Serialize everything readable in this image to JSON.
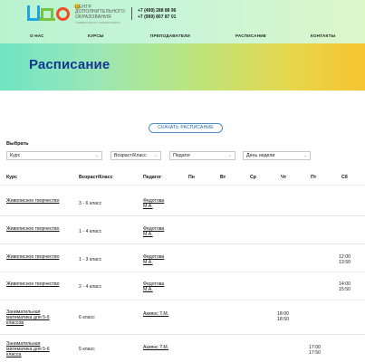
{
  "header": {
    "logo_text": "ЦДО",
    "logo_caption": [
      "ЦЕНТР",
      "ДОПОЛНИТЕЛЬНОГО",
      "ОБРАЗОВАНИЯ"
    ],
    "logo_subcaption": "УНИВЕРСИТЕТА ГУМАНИТАРНЫХ",
    "phones": [
      "+7 (499) 288 88 96",
      "+7 (999) 807 87 01"
    ],
    "nav": [
      "О НАС",
      "КУРСЫ",
      "ПРЕПОДАВАТЕЛИ",
      "РАСПИСАНИЕ",
      "КОНТАКТЫ"
    ]
  },
  "banner": {
    "title": "Расписание"
  },
  "download_button": "СКАЧАТЬ РАСПИСАНИЕ",
  "filters": {
    "label": "Выбрать",
    "selects": [
      "Курс",
      "Возраст/Класс",
      "Педагог",
      "День недели"
    ]
  },
  "table": {
    "columns": [
      "Курс",
      "Возраст/Класс",
      "Педагог",
      "Пн",
      "Вт",
      "Ср",
      "Чт",
      "Пт",
      "Сб"
    ],
    "rows": [
      {
        "course": "Живописное творчество",
        "age": "3 - 6 класс",
        "teacher": "Федотова М.А.",
        "times": {}
      },
      {
        "course": "Живописное творчество",
        "age": "1 - 4 класс",
        "teacher": "Федотова М.А.",
        "times": {}
      },
      {
        "course": "Живописное творчество",
        "age": "1 - 3 класс",
        "teacher": "Федотова М.А.",
        "times": {
          "sb": [
            "12:00",
            "13:50"
          ]
        }
      },
      {
        "course": "Живописное творчество",
        "age": "2 - 4 класс",
        "teacher": "Федотова М.А.",
        "times": {
          "sb": [
            "14:00",
            "15:50"
          ]
        }
      },
      {
        "course": "Занимательная математика для 5-6 классов",
        "age": "6 класс",
        "teacher": "Акиянс Т.М.",
        "times": {
          "cht": [
            "18:00",
            "18:50"
          ]
        }
      },
      {
        "course": "Занимательная математика для 5-6 класса",
        "age": "5 класс",
        "teacher": "Акиянс Т.М.",
        "times": {
          "pt": [
            "17:00",
            "17:50"
          ]
        }
      }
    ]
  },
  "colors": {
    "title": "#15368f",
    "accent": "#2566a8"
  }
}
